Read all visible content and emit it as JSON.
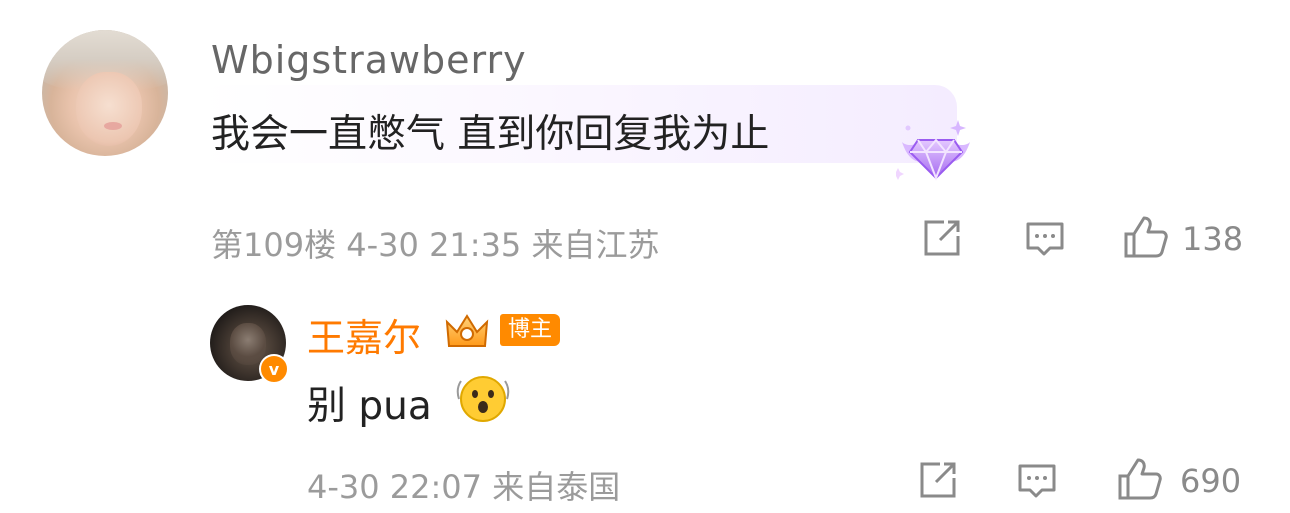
{
  "comments": [
    {
      "username": "Wbigstrawberry",
      "text": "我会一直憋气 直到你回复我为止",
      "floor": "第109楼",
      "datetime": "4-30 21:35",
      "location": "来自江苏",
      "likes": "138",
      "badge_icon": "gem-wings-icon",
      "accent": "#b38cf5"
    },
    {
      "username": "王嘉尔",
      "text": "别 pua",
      "role_badge": "博主",
      "datetime": "4-30 22:07",
      "location": "来自泰国",
      "likes": "690",
      "verified_mark": "v",
      "emoji_icon": "astonished-face-icon",
      "name_color": "#ff7a00"
    }
  ],
  "icons": {
    "share": "share-icon",
    "reply": "comment-icon",
    "like": "thumbs-up-icon"
  }
}
